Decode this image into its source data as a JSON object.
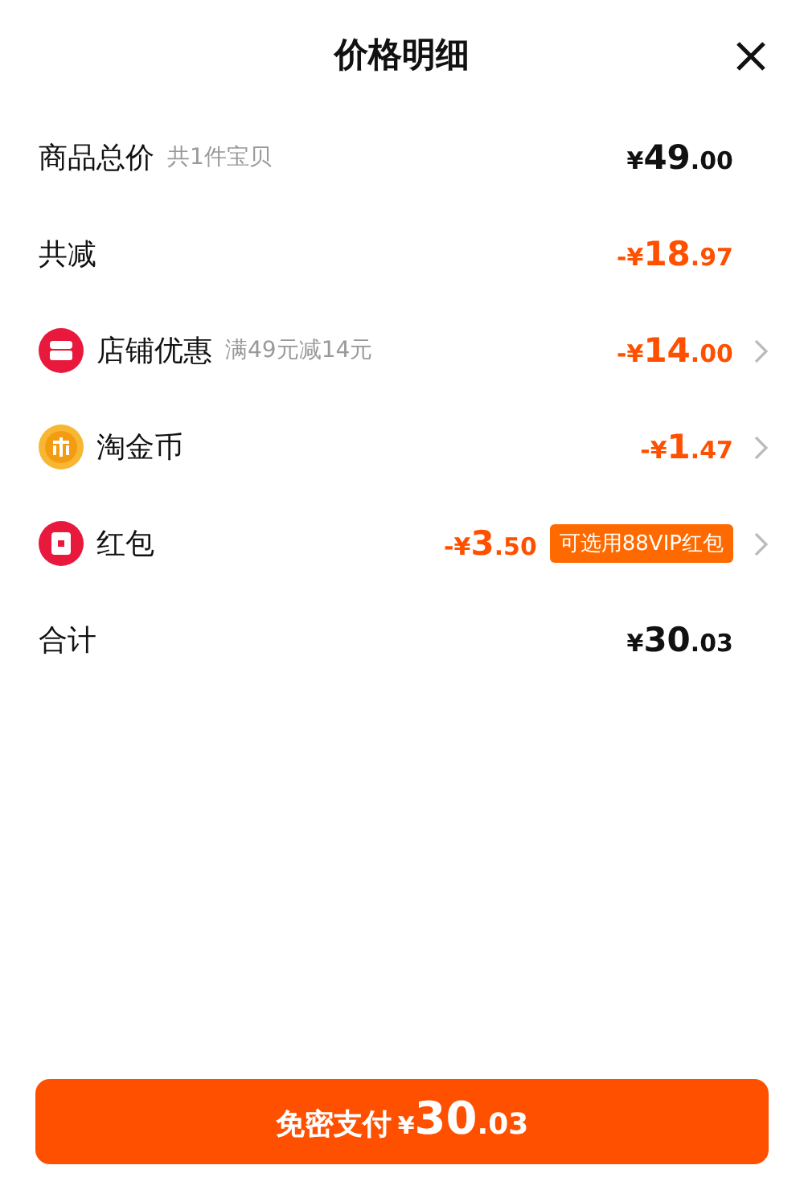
{
  "title": "价格明细",
  "rows": [
    {
      "kind": "plain",
      "label": "商品总价",
      "note": "共1件宝贝",
      "amount": {
        "sign": "¥",
        "whole": "49",
        "fraction": ".00"
      }
    },
    {
      "kind": "reduction",
      "label": "共减",
      "amount": {
        "sign": "-¥",
        "whole": "18",
        "fraction": ".97"
      }
    },
    {
      "kind": "discount",
      "label": "店铺优惠",
      "note": "满49元减14元",
      "amount": {
        "sign": "-¥",
        "whole": "14",
        "fraction": ".00"
      }
    },
    {
      "kind": "discount",
      "label": "淘金币",
      "amount": {
        "sign": "-¥",
        "whole": "1",
        "fraction": ".47"
      }
    },
    {
      "kind": "discount",
      "label": "红包",
      "amount": {
        "sign": "-¥",
        "whole": "3",
        "fraction": ".50"
      },
      "tag": "可选用88VIP红包"
    },
    {
      "kind": "plain",
      "label": "合计",
      "amount": {
        "sign": "¥",
        "whole": "30",
        "fraction": ".03"
      }
    }
  ],
  "pay_button": {
    "label": "免密支付",
    "amount": {
      "sign": "¥",
      "whole": "30",
      "fraction": ".03"
    }
  }
}
